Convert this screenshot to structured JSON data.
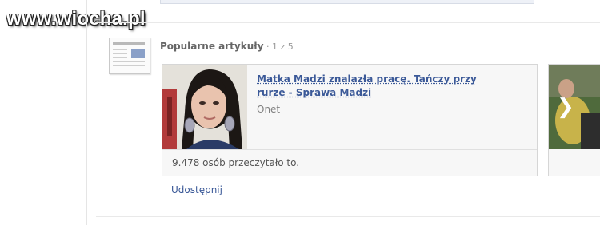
{
  "watermark": {
    "text": "www.wiocha.pl"
  },
  "feed": {
    "heading": "Popularne artykuły",
    "pager": " · 1 z 5",
    "article": {
      "title": "Matka Madzi znalazła pracę. Tańczy przy rurze - Sprawa Madzi",
      "source": "Onet",
      "reads": "9.478 osób przeczytało to."
    },
    "share_label": "Udostępnij",
    "icons": {
      "news": "newspaper-icon",
      "next": "chevron-right-icon"
    }
  },
  "colors": {
    "link": "#3b5998",
    "muted": "#808080",
    "card_bg": "#f7f7f7",
    "border": "#d6d6d6"
  }
}
